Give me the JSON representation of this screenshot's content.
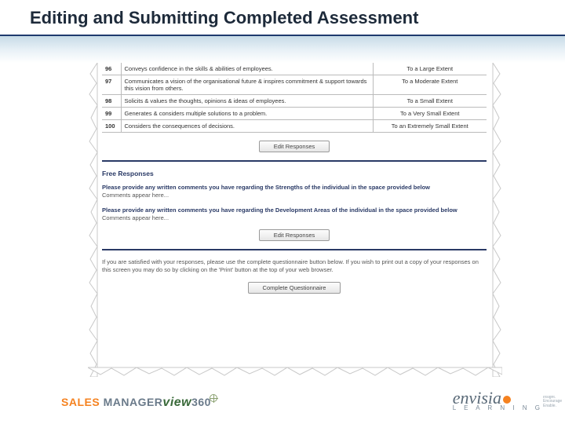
{
  "title": "Editing and Submitting Completed Assessment",
  "rows": [
    {
      "num": "96",
      "desc": "Conveys confidence in the skills & abilities of employees.",
      "ext": "To a Large Extent"
    },
    {
      "num": "97",
      "desc": "Communicates a vision of the organisational future & inspires commitment & support towards this vision from others.",
      "ext": "To a Moderate Extent"
    },
    {
      "num": "98",
      "desc": "Solicits & values the thoughts, opinions & ideas of employees.",
      "ext": "To a Small Extent"
    },
    {
      "num": "99",
      "desc": "Generates & considers multiple solutions to a problem.",
      "ext": "To a Very Small Extent"
    },
    {
      "num": "100",
      "desc": "Considers the consequences of decisions.",
      "ext": "To an Extremely Small Extent"
    }
  ],
  "buttons": {
    "edit1": "Edit Responses",
    "edit2": "Edit Responses",
    "complete": "Complete Questionnaire"
  },
  "free_responses": {
    "heading": "Free Responses",
    "strengths_prompt": "Please provide any written comments you have regarding the Strengths of the individual in the space provided below",
    "strengths_placeholder": "Comments appear here...",
    "dev_prompt": "Please provide any written comments you have regarding the Development Areas of the individual in the space provided below",
    "dev_placeholder": "Comments appear here..."
  },
  "instructions": "If you are satisfied with your responses, please use the complete questionnaire button below. If you wish to print out a copy of your responses on this screen you may do so by clicking on the 'Print' button at the top of your web browser.",
  "brand_left": {
    "sales": "SALES ",
    "manager": "MANAGER",
    "view": "view",
    "n360": "360"
  },
  "brand_right": {
    "name": "envisia",
    "sub": "L E A R N I N G"
  },
  "tagline": "Insight. Encourage. Enable."
}
